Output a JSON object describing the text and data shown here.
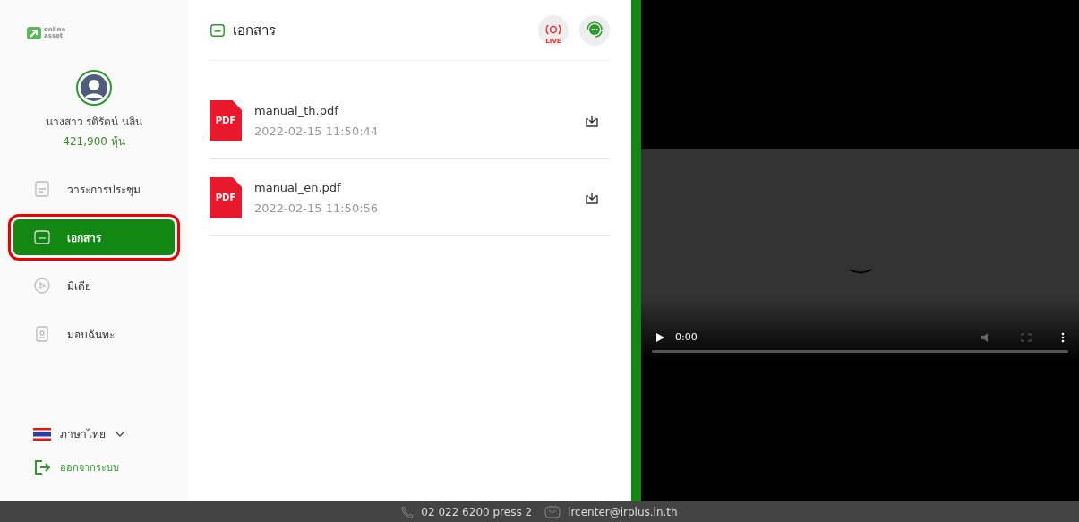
{
  "logo": {
    "line_1": "online",
    "line_2": "asset"
  },
  "user": {
    "name": "นางสาว รติรัตน์ นลิน",
    "shares": "421,900 หุ้น"
  },
  "nav": [
    {
      "kind": "agenda",
      "label": "วาระการประชุม",
      "selected": false,
      "circled": false
    },
    {
      "kind": "documents",
      "label": "เอกสาร",
      "selected": true,
      "circled": true
    },
    {
      "kind": "media",
      "label": "มีเดีย",
      "selected": false,
      "circled": false
    },
    {
      "kind": "proxy",
      "label": "มอบฉันทะ",
      "selected": false,
      "circled": false
    }
  ],
  "language": {
    "label": "ภาษาไทย"
  },
  "logout": {
    "label": "ออกจากระบบ"
  },
  "panel": {
    "title": "เอกสาร",
    "live_badge": "LIVE"
  },
  "documents": [
    {
      "badge": "PDF",
      "name": "manual_th.pdf",
      "date": "2022-02-15 11:50:44"
    },
    {
      "badge": "PDF",
      "name": "manual_en.pdf",
      "date": "2022-02-15 11:50:56"
    }
  ],
  "video": {
    "time": "0:00"
  },
  "footer": {
    "phone": "02 022 6200 press 2",
    "email": "ircenter@irplus.in.th"
  }
}
